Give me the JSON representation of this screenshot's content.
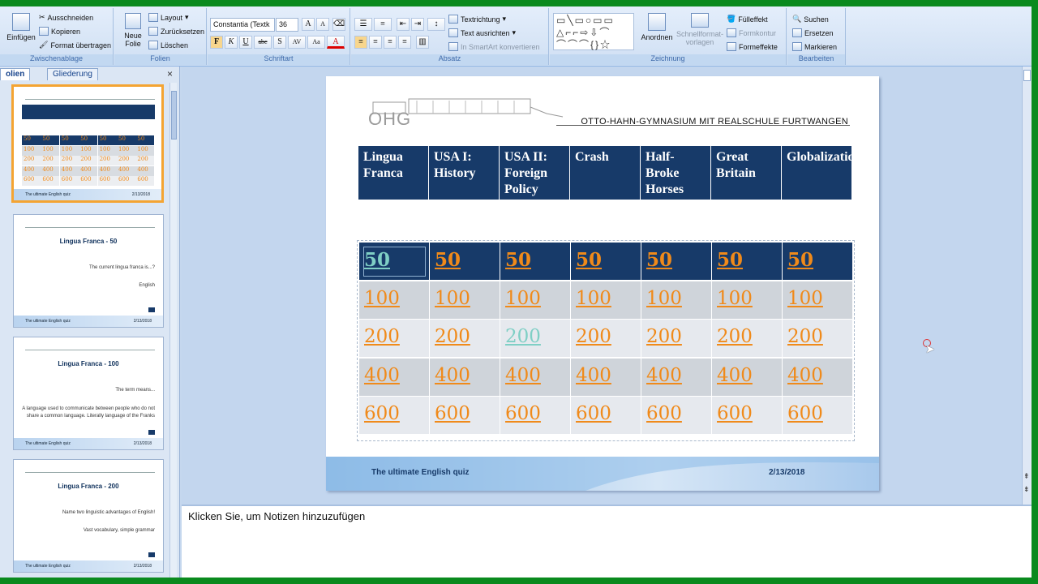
{
  "ribbon": {
    "clipboard": {
      "paste": "Einfügen",
      "cut": "Ausschneiden",
      "copy": "Kopieren",
      "format_painter": "Format übertragen",
      "label": "Zwischenablage"
    },
    "slides": {
      "new_slide": "Neue Folie",
      "layout": "Layout",
      "reset": "Zurücksetzen",
      "delete": "Löschen",
      "label": "Folien"
    },
    "font": {
      "family": "Constantia (Textk",
      "size": "36",
      "bold": "F",
      "italic": "K",
      "underline": "U",
      "strike": "abc",
      "shadow": "S",
      "spacing": "AV",
      "case": "Aa",
      "color": "A",
      "label": "Schriftart"
    },
    "paragraph": {
      "text_direction": "Textrichtung",
      "align_text": "Text ausrichten",
      "smartart": "In SmartArt konvertieren",
      "label": "Absatz"
    },
    "drawing": {
      "arrange": "Anordnen",
      "quick_styles": "Schnellformat-vorlagen",
      "fill": "Fülleffekt",
      "outline": "Formkontur",
      "effects": "Formeffekte",
      "label": "Zeichnung"
    },
    "editing": {
      "find": "Suchen",
      "replace": "Ersetzen",
      "select": "Markieren",
      "label": "Bearbeiten"
    }
  },
  "panel": {
    "tab_slides": "olien",
    "tab_outline": "Gliederung",
    "close": "×"
  },
  "thumbs": [
    {
      "title": "",
      "lines": []
    },
    {
      "title": "Lingua Franca - 50",
      "lines": [
        "The current lingua franca is...?",
        "English"
      ]
    },
    {
      "title": "Lingua Franca - 100",
      "lines": [
        "The term means...",
        "A language used to communicate between people who do not share a common language. Literally language of the Franks"
      ]
    },
    {
      "title": "Lingua Franca - 200",
      "lines": [
        "Name two linguistic advantages of English!",
        "Vast vocabulary, simple grammar"
      ]
    }
  ],
  "thumb_footer": {
    "left": "The ultimate English quiz",
    "right": "2/13/2018"
  },
  "slide": {
    "logo": "OHG",
    "school": "OTTO-HAHN-GYMNASIUM MIT REALSCHULE FURTWANGEN",
    "categories": [
      "Lingua Franca",
      "USA I: History",
      "USA II: Foreign Policy",
      "Crash",
      "Half-Broke Horses",
      "Great Britain",
      "Globalization"
    ],
    "rows": [
      [
        "50",
        "50",
        "50",
        "50",
        "50",
        "50",
        "50"
      ],
      [
        "100",
        "100",
        "100",
        "100",
        "100",
        "100",
        "100"
      ],
      [
        "200",
        "200",
        "200",
        "200",
        "200",
        "200",
        "200"
      ],
      [
        "400",
        "400",
        "400",
        "400",
        "400",
        "400",
        "400"
      ],
      [
        "600",
        "600",
        "600",
        "600",
        "600",
        "600",
        "600"
      ]
    ],
    "footer_left": "The ultimate English quiz",
    "footer_right": "2/13/2018"
  },
  "notes": {
    "placeholder": "Klicken Sie, um  Notizen hinzuzufügen"
  },
  "colors": {
    "header": "#173a69",
    "value": "#f08a1a",
    "visited": "#7fcfc5",
    "accent_frame": "#0a8a1e"
  }
}
